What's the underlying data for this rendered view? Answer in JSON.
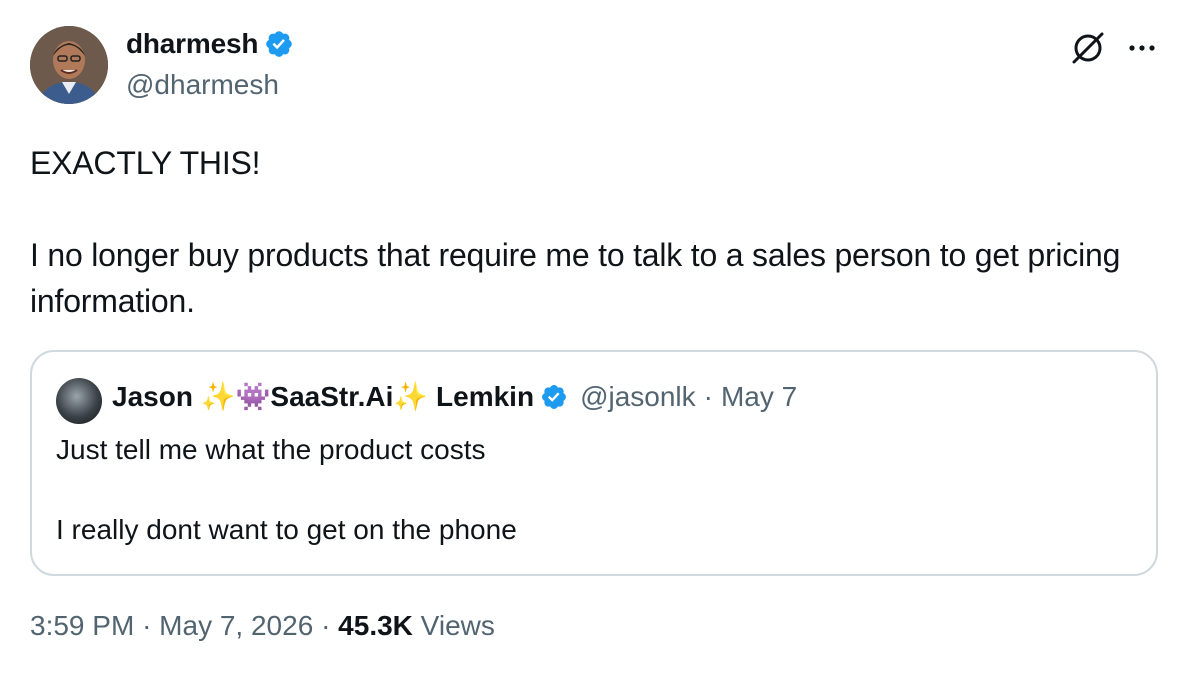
{
  "author": {
    "display_name": "dharmesh",
    "handle": "@dharmesh",
    "verified": true
  },
  "header_icons": [
    "grok-icon",
    "more-options-icon"
  ],
  "tweet": {
    "text": "EXACTLY THIS!\n\nI no longer buy products that require me to talk to a sales person to get pricing information."
  },
  "quoted_tweet": {
    "display_name": "Jason ✨👾SaaStr.Ai✨ Lemkin",
    "verified": true,
    "handle": "@jasonlk",
    "separator": "·",
    "date": "May 7",
    "text": "Just tell me what the product costs\n\nI really dont want to get on the phone"
  },
  "meta": {
    "time": "3:59 PM",
    "separator": "·",
    "date": "May 7, 2026",
    "views_count": "45.3K",
    "views_label": "Views"
  },
  "colors": {
    "text_primary": "#0f1419",
    "text_secondary": "#536471",
    "verified_blue": "#1d9bf0",
    "border": "#cfd9de"
  }
}
